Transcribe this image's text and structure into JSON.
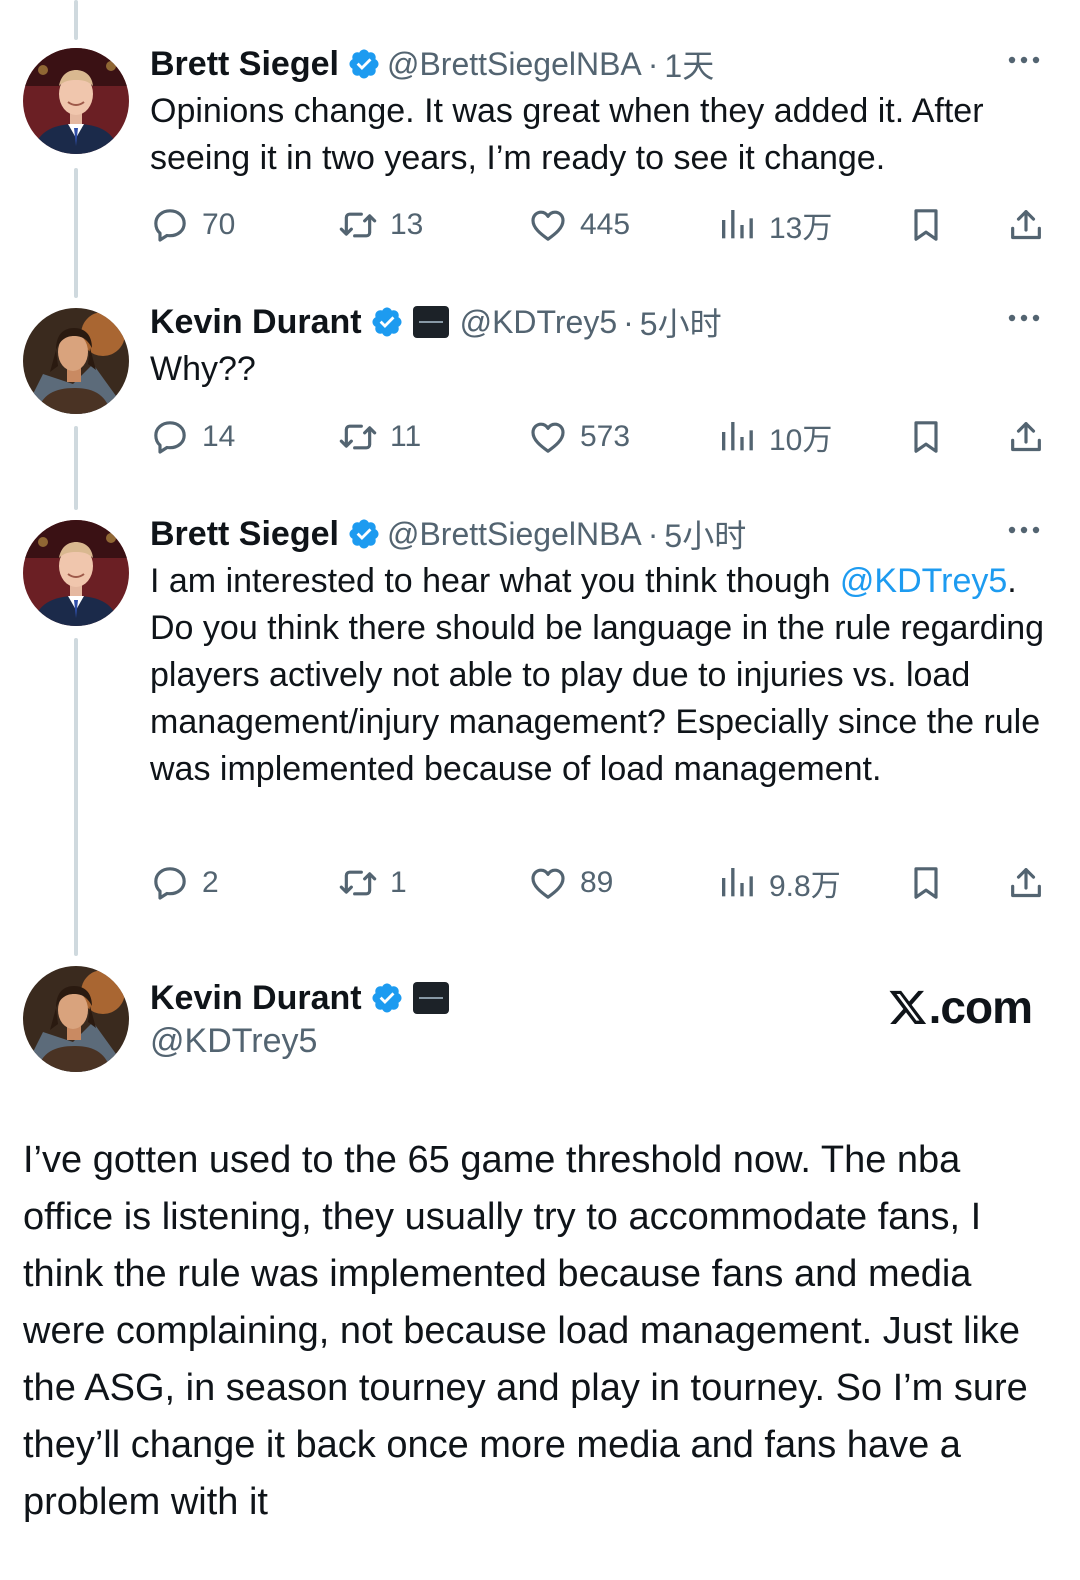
{
  "colors": {
    "verified": "#1d9bf0",
    "mention": "#1d9bf0",
    "muted": "#536471",
    "text": "#0f1419",
    "thread_line": "#cfd9de"
  },
  "tweets": [
    {
      "name": "Brett Siegel",
      "handle": "@BrettSiegelNBA",
      "separator": "·",
      "time": "1天",
      "avatar": "avatar-brett",
      "has_affiliation": false,
      "text_pre": "Opinions change. It was great when they added it. After seeing it in two years, I’m ready to see it change.",
      "mention": "",
      "text_post": "",
      "replies": "70",
      "reposts": "13",
      "likes": "445",
      "views": "13万"
    },
    {
      "name": "Kevin Durant",
      "handle": "@KDTrey5",
      "separator": "·",
      "time": "5小时",
      "avatar": "avatar-kd",
      "has_affiliation": true,
      "text_pre": "Why??",
      "mention": "",
      "text_post": "",
      "replies": "14",
      "reposts": "11",
      "likes": "573",
      "views": "10万"
    },
    {
      "name": "Brett Siegel",
      "handle": "@BrettSiegelNBA",
      "separator": "·",
      "time": "5小时",
      "avatar": "avatar-brett",
      "has_affiliation": false,
      "text_pre": "I am interested to hear what you think though ",
      "mention": "@KDTrey5",
      "text_post": ". Do you think there should be language in the rule regarding players actively not able to play due to injuries vs. load management/injury management? Especially since the rule was implemented because of load management.",
      "replies": "2",
      "reposts": "1",
      "likes": "89",
      "views": "9.8万"
    }
  ],
  "main_tweet": {
    "name": "Kevin Durant",
    "handle": "@KDTrey5",
    "brand": ".com",
    "text": "I’ve gotten used to the 65 game threshold now. The nba office is listening, they usually try to accommodate fans, I think the rule was implemented because fans and media were complaining, not because load management. Just like the ASG, in season tourney and play in tourney. So I’m sure they’ll change it back once more media and fans have a problem with it"
  }
}
